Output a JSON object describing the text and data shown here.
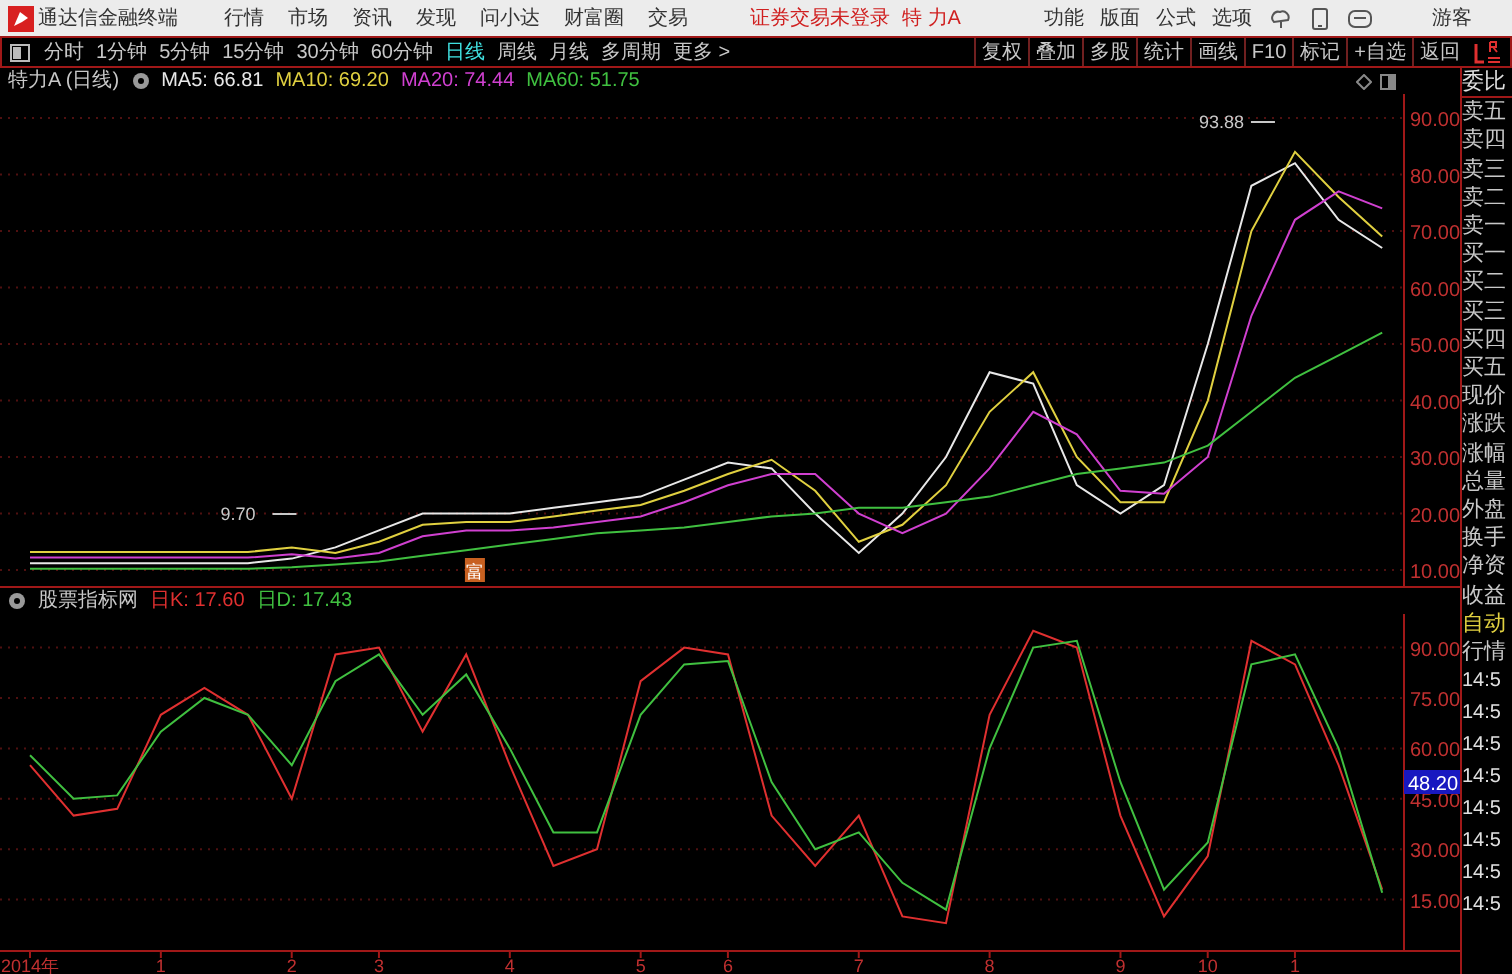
{
  "header": {
    "app_title": "通达信金融终端",
    "menu": [
      "行情",
      "市场",
      "资讯",
      "发现",
      "问小达",
      "财富圈",
      "交易"
    ],
    "login_status": "证券交易未登录",
    "stock_name": "特 力A",
    "tools": [
      "功能",
      "版面",
      "公式",
      "选项"
    ],
    "user": "游客"
  },
  "toolbar": {
    "periods": [
      {
        "label": "分时",
        "selected": false
      },
      {
        "label": "1分钟",
        "selected": false
      },
      {
        "label": "5分钟",
        "selected": false
      },
      {
        "label": "15分钟",
        "selected": false
      },
      {
        "label": "30分钟",
        "selected": false
      },
      {
        "label": "60分钟",
        "selected": false
      },
      {
        "label": "日线",
        "selected": true
      },
      {
        "label": "周线",
        "selected": false
      },
      {
        "label": "月线",
        "selected": false
      },
      {
        "label": "多周期",
        "selected": false
      },
      {
        "label": "更多 >",
        "selected": false
      }
    ],
    "actions": [
      "复权",
      "叠加",
      "多股",
      "统计",
      "画线",
      "F10",
      "标记",
      "+自选",
      "返回"
    ]
  },
  "legend_separator": ": ",
  "info_line": {
    "title": "特力A (日线)",
    "legend": [
      "66.81",
      "69.20",
      "74.44",
      "51.75"
    ]
  },
  "price_chart": {
    "event_marker": "富",
    "chart_data": {
      "type": "line",
      "grid": true,
      "ylim": [
        10,
        90
      ],
      "yticks": [
        {
          "value": 10,
          "label": "10.00"
        },
        {
          "value": 20,
          "label": "20.00"
        },
        {
          "value": 30,
          "label": "30.00"
        },
        {
          "value": 40,
          "label": "40.00"
        },
        {
          "value": 50,
          "label": "50.00"
        },
        {
          "value": 60,
          "label": "60.00"
        },
        {
          "value": 70,
          "label": "70.00"
        },
        {
          "value": 80,
          "label": "80.00"
        },
        {
          "value": 90,
          "label": "90.00"
        }
      ],
      "series": [
        {
          "name": "MA5",
          "color": "#e8e8e8",
          "values": [
            11.2,
            11.2,
            11.2,
            11.2,
            11.2,
            11.2,
            12,
            14,
            17,
            20,
            20,
            20,
            21,
            22,
            23,
            26,
            29,
            28,
            20,
            13,
            20,
            30,
            45,
            43,
            25,
            20,
            25,
            50,
            78,
            82,
            72,
            67
          ]
        },
        {
          "name": "MA10",
          "color": "#e0d040",
          "values": [
            13.2,
            13.2,
            13.2,
            13.2,
            13.2,
            13.2,
            14,
            13,
            15,
            18,
            18.5,
            18.5,
            19.5,
            20.5,
            21.5,
            24,
            27,
            29.5,
            24,
            15,
            18,
            25,
            38,
            45,
            30,
            22,
            22,
            40,
            70,
            84,
            76,
            69
          ]
        },
        {
          "name": "MA20",
          "color": "#d040d0",
          "values": [
            12.2,
            12.2,
            12.2,
            12.2,
            12.2,
            12.2,
            12.8,
            12,
            13,
            16,
            17,
            17,
            17.5,
            18.5,
            19.5,
            22,
            25,
            27,
            27,
            20,
            16.5,
            20,
            28,
            38,
            34,
            24,
            23.5,
            30,
            55,
            72,
            77,
            74
          ]
        },
        {
          "name": "MA60",
          "color": "#40c040",
          "values": [
            10.2,
            10.2,
            10.2,
            10.2,
            10.2,
            10.2,
            10.5,
            11,
            11.5,
            12.5,
            13.5,
            14.5,
            15.5,
            16.5,
            17,
            17.5,
            18.5,
            19.5,
            20,
            21,
            21,
            22,
            23,
            25,
            27,
            28,
            29,
            32,
            38,
            44,
            48,
            52
          ]
        }
      ],
      "annotations": [
        {
          "text": "93.88"
        },
        {
          "text": "9.70"
        }
      ]
    }
  },
  "indicator": {
    "name": "股票指标网",
    "legend": [
      "17.60",
      "17.43"
    ],
    "cursor_value": "48.20",
    "chart_data": {
      "type": "line",
      "grid": true,
      "ylim": [
        0,
        100
      ],
      "yticks": [
        {
          "value": 15,
          "label": "15.00"
        },
        {
          "value": 30,
          "label": "30.00"
        },
        {
          "value": 45,
          "label": "45.00"
        },
        {
          "value": 60,
          "label": "60.00"
        },
        {
          "value": 75,
          "label": "75.00"
        },
        {
          "value": 90,
          "label": "90.00"
        }
      ],
      "categories": [
        "2014年",
        null,
        null,
        "1",
        null,
        null,
        "2",
        null,
        "3",
        null,
        null,
        "4",
        null,
        null,
        "5",
        null,
        "6",
        null,
        null,
        "7",
        null,
        null,
        "8",
        null,
        null,
        "9",
        null,
        "10",
        null,
        "1",
        null,
        null
      ],
      "series": [
        {
          "name": "日K",
          "color": "#e03030",
          "values": [
            55,
            40,
            42,
            70,
            78,
            70,
            45,
            88,
            90,
            65,
            88,
            55,
            25,
            30,
            80,
            90,
            88,
            40,
            25,
            40,
            10,
            8,
            70,
            95,
            90,
            40,
            10,
            28,
            92,
            85,
            55,
            18
          ]
        },
        {
          "name": "日D",
          "color": "#40c040",
          "values": [
            58,
            45,
            46,
            65,
            75,
            70,
            55,
            80,
            88,
            70,
            82,
            60,
            35,
            35,
            70,
            85,
            86,
            50,
            30,
            35,
            20,
            12,
            60,
            90,
            92,
            50,
            18,
            32,
            85,
            88,
            60,
            17
          ]
        }
      ]
    }
  },
  "quote_panel": {
    "labels": [
      {
        "text": "委比",
        "kind": "header"
      },
      {
        "text": "卖五",
        "kind": "item"
      },
      {
        "text": "卖四",
        "kind": "item"
      },
      {
        "text": "卖三",
        "kind": "item"
      },
      {
        "text": "卖二",
        "kind": "item"
      },
      {
        "text": "卖一",
        "kind": "item"
      },
      {
        "text": "买一",
        "kind": "item"
      },
      {
        "text": "买二",
        "kind": "item"
      },
      {
        "text": "买三",
        "kind": "item"
      },
      {
        "text": "买四",
        "kind": "item"
      },
      {
        "text": "买五",
        "kind": "item"
      },
      {
        "text": "现价",
        "kind": "item"
      },
      {
        "text": "涨跌",
        "kind": "item"
      },
      {
        "text": "涨幅",
        "kind": "item"
      },
      {
        "text": "总量",
        "kind": "item"
      },
      {
        "text": "外盘",
        "kind": "item"
      },
      {
        "text": "换手",
        "kind": "item"
      },
      {
        "text": "净资",
        "kind": "item"
      },
      {
        "text": "收益",
        "kind": "item"
      },
      {
        "text": "自动",
        "kind": "highlight"
      },
      {
        "text": "行情",
        "kind": "item"
      }
    ],
    "times": [
      "14:5",
      "14:5",
      "14:5",
      "14:5",
      "14:5",
      "14:5",
      "14:5",
      "14:5"
    ]
  }
}
